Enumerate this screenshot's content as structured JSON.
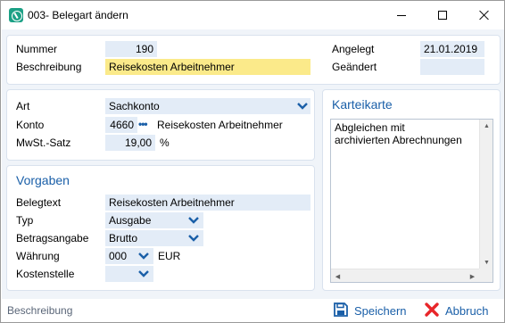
{
  "window": {
    "title": "003- Belegart ändern"
  },
  "header_panel": {
    "nummer_label": "Nummer",
    "nummer_value": "190",
    "beschreibung_label": "Beschreibung",
    "beschreibung_value": "Reisekosten Arbeitnehmer",
    "angelegt_label": "Angelegt",
    "angelegt_value": "21.01.2019",
    "geaendert_label": "Geändert",
    "geaendert_value": ""
  },
  "account_panel": {
    "art_label": "Art",
    "art_value": "Sachkonto",
    "konto_label": "Konto",
    "konto_value": "4660",
    "konto_dots": "•••",
    "konto_name": "Reisekosten Arbeitnehmer",
    "mwst_label": "MwSt.-Satz",
    "mwst_value": "19,00",
    "mwst_unit": "%"
  },
  "vorgaben_panel": {
    "heading": "Vorgaben",
    "belegtext_label": "Belegtext",
    "belegtext_value": "Reisekosten Arbeitnehmer",
    "typ_label": "Typ",
    "typ_value": "Ausgabe",
    "betragsangabe_label": "Betragsangabe",
    "betragsangabe_value": "Brutto",
    "waehrung_label": "Währung",
    "waehrung_value": "000",
    "waehrung_unit": "EUR",
    "kostenstelle_label": "Kostenstelle",
    "kostenstelle_value": ""
  },
  "karteikarte_panel": {
    "heading": "Karteikarte",
    "memo_text": "Abgleichen mit\narchivierten Abrechnungen"
  },
  "footer": {
    "status_text": "Beschreibung",
    "save_label": "Speichern",
    "cancel_label": "Abbruch"
  },
  "colors": {
    "accent": "#1a5fa8",
    "field_bg": "#e3ecf7",
    "highlight_field": "#fbea8a",
    "cancel_icon": "#e8262a",
    "app_icon": "#1ba085"
  },
  "icons": {
    "app": "app-logo-icon",
    "save": "floppy-disk-icon",
    "cancel": "red-x-icon",
    "dropdown": "chevron-down-icon"
  }
}
